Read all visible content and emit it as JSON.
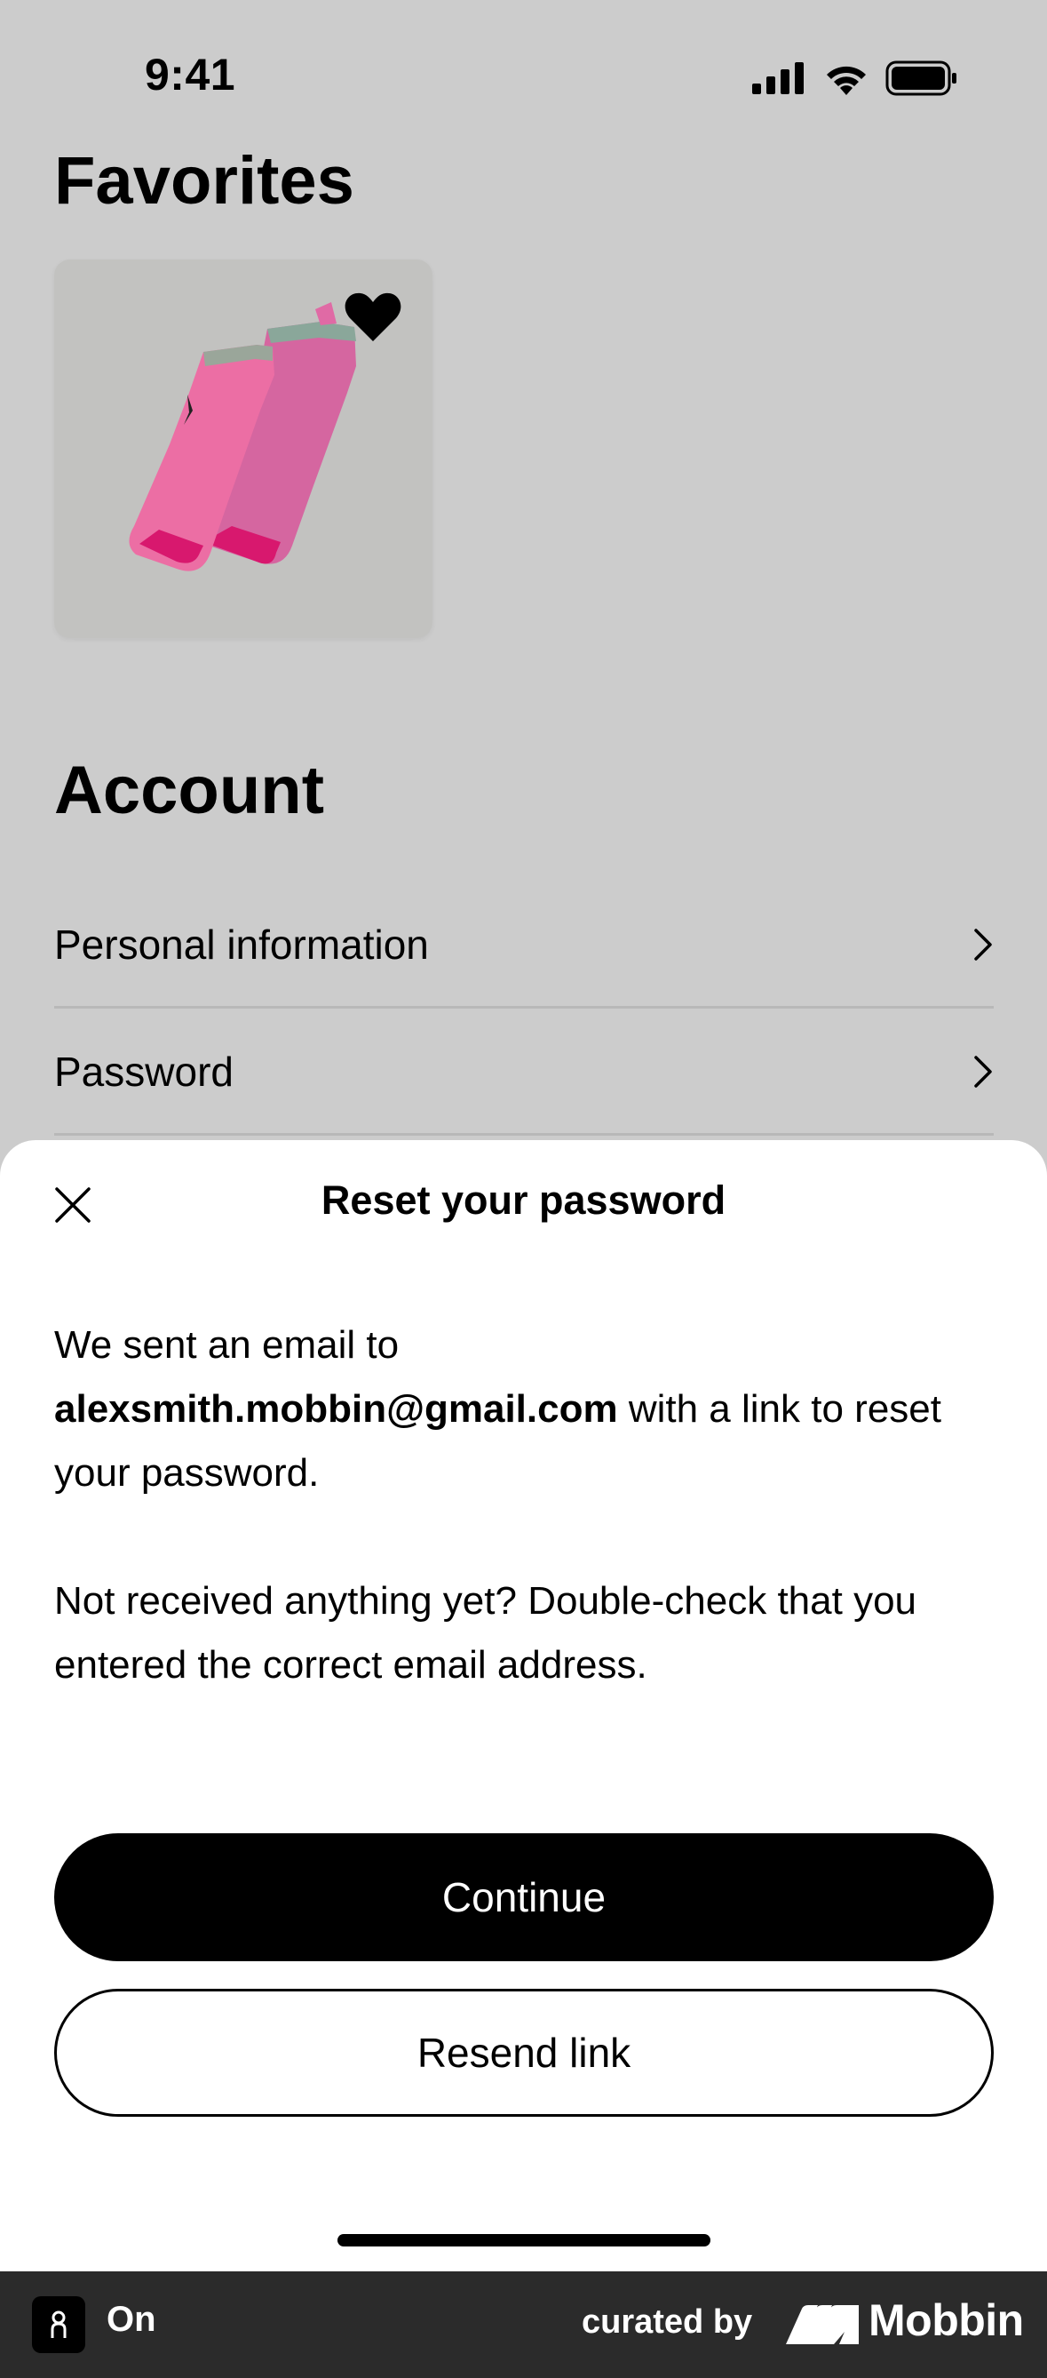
{
  "status_bar": {
    "time": "9:41",
    "icons": [
      "cellular-signal-icon",
      "wifi-icon",
      "battery-icon"
    ]
  },
  "favorites": {
    "title": "Favorites",
    "items": [
      {
        "image": "pink-ankle-socks",
        "favorited": true,
        "heart_icon": "heart-filled-icon"
      }
    ]
  },
  "account": {
    "title": "Account",
    "items": [
      {
        "label": "Personal information",
        "icon": "chevron-right-icon"
      },
      {
        "label": "Password",
        "icon": "chevron-right-icon"
      }
    ]
  },
  "sheet": {
    "close_icon": "close-icon",
    "title": "Reset your password",
    "message_prefix": "We sent an email to",
    "email": "alexsmith.mobbin@gmail.com",
    "message_suffix": "with a link to reset your password.",
    "message_2": "Not received anything yet? Double-check that you entered the correct email address.",
    "primary_button": "Continue",
    "secondary_button": "Resend link"
  },
  "footer": {
    "app_name": "On",
    "curated_by": "curated by",
    "brand": "Mobbin"
  },
  "colors": {
    "overlay_background": "#cccccc",
    "sheet_background": "#ffffff",
    "primary_button": "#000000",
    "footer_background": "#2b2b2b",
    "sock_pink": "#e96aa8"
  }
}
